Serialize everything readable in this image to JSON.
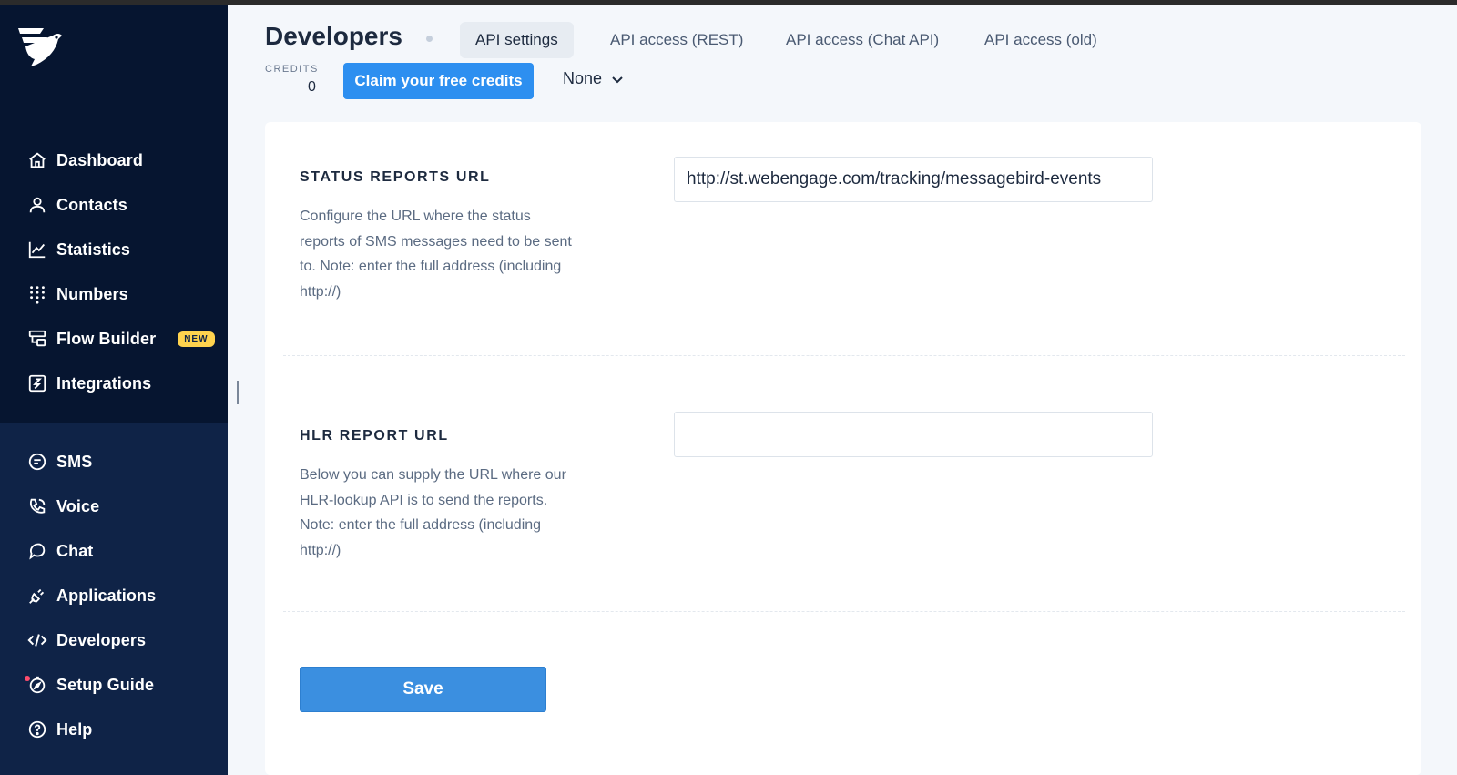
{
  "sidebar": {
    "primary": [
      {
        "label": "Dashboard",
        "icon": "home-icon"
      },
      {
        "label": "Contacts",
        "icon": "user-icon"
      },
      {
        "label": "Statistics",
        "icon": "chart-icon"
      },
      {
        "label": "Numbers",
        "icon": "dialpad-icon"
      },
      {
        "label": "Flow Builder",
        "icon": "flow-icon",
        "badge": "NEW"
      },
      {
        "label": "Integrations",
        "icon": "integrations-icon"
      }
    ],
    "secondary": [
      {
        "label": "SMS",
        "icon": "sms-icon"
      },
      {
        "label": "Voice",
        "icon": "phone-icon"
      },
      {
        "label": "Chat",
        "icon": "chat-icon"
      },
      {
        "label": "Applications",
        "icon": "plug-icon"
      },
      {
        "label": "Developers",
        "icon": "code-icon"
      },
      {
        "label": "Setup Guide",
        "icon": "compass-icon"
      },
      {
        "label": "Help",
        "icon": "help-icon"
      }
    ]
  },
  "header": {
    "title": "Developers",
    "tabs": [
      {
        "label": "API settings",
        "active": true
      },
      {
        "label": "API access (REST)",
        "active": false
      },
      {
        "label": "API access (Chat API)",
        "active": false
      },
      {
        "label": "API access (old)",
        "active": false
      }
    ],
    "credits_label": "CREDITS",
    "credits_value": "0",
    "claim_button": "Claim your free credits",
    "dropdown_value": "None"
  },
  "settings": {
    "status_reports": {
      "label": "STATUS REPORTS URL",
      "description": "Configure the URL where the status reports of SMS messages need to be sent to. Note: enter the full address (including http://)",
      "value": "http://st.webengage.com/tracking/messagebird-events"
    },
    "hlr_report": {
      "label": "HLR REPORT URL",
      "description": "Below you can supply the URL where our HLR-lookup API is to send the reports. Note: enter the full address (including http://)",
      "value": ""
    },
    "save_label": "Save"
  },
  "colors": {
    "sidebar_top": "#061530",
    "sidebar_bottom": "#0f2347",
    "accent": "#2d8ff0",
    "badge": "#ffd34e"
  }
}
